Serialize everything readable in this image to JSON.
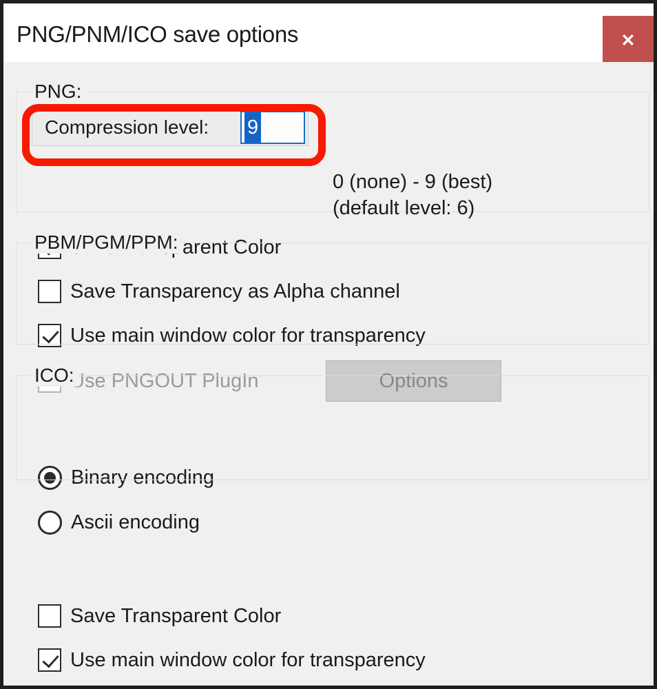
{
  "window": {
    "title": "PNG/PNM/ICO save options",
    "close_label": "✕",
    "accent_close_color": "#c0504d",
    "annotation_color": "#f61a00",
    "selection_color": "#1464c8"
  },
  "png_group": {
    "label": "PNG:",
    "compression": {
      "label": "Compression level:",
      "value": "9",
      "placeholder": "",
      "hint_line1": "0 (none) - 9 (best)",
      "hint_line2": "(default level: 6)"
    },
    "checkboxes": [
      {
        "label": "Save Transparent Color",
        "checked": true,
        "disabled": false
      },
      {
        "label": "Save Transparency as Alpha channel",
        "checked": false,
        "disabled": false
      },
      {
        "label": "Use main window color for transparency",
        "checked": true,
        "disabled": false
      },
      {
        "label": "Use PNGOUT PlugIn",
        "checked": false,
        "disabled": true
      }
    ],
    "options_button": {
      "label": "Options",
      "disabled": true
    }
  },
  "pbm_group": {
    "label": "PBM/PGM/PPM:",
    "radios": [
      {
        "label": "Binary encoding",
        "selected": true
      },
      {
        "label": "Ascii encoding",
        "selected": false
      }
    ]
  },
  "ico_group": {
    "label": "ICO:",
    "checkboxes": [
      {
        "label": "Save Transparent Color",
        "checked": false,
        "disabled": false
      },
      {
        "label": "Use main window color for transparency",
        "checked": true,
        "disabled": false
      }
    ]
  }
}
